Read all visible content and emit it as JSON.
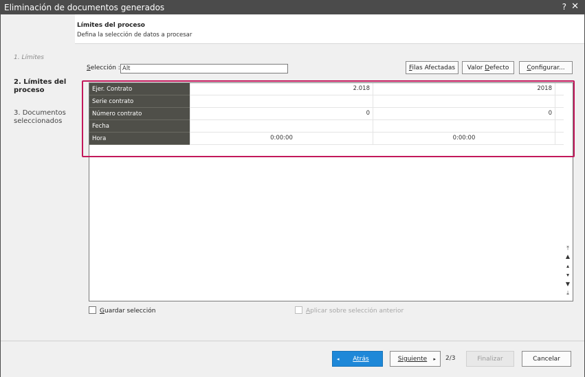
{
  "window": {
    "title": "Eliminación de documentos generados",
    "help_label": "?",
    "close_label": "✕"
  },
  "sidebar": {
    "steps": [
      {
        "label": "1. Límites"
      },
      {
        "label": "2. Límites del proceso"
      },
      {
        "label": "3. Documentos seleccionados"
      }
    ]
  },
  "header": {
    "title": "Límites del proceso",
    "subtitle": "Defina la selección de datos a procesar"
  },
  "selection": {
    "label_prefix": "S",
    "label_rest": "elección :",
    "value": "Alt"
  },
  "toolbar": {
    "filas_first": "F",
    "filas_rest": "ilas Afectadas",
    "valor_pre": "Valor ",
    "valor_u": "D",
    "valor_rest": "efecto",
    "config_first": "C",
    "config_rest": "onfigurar..."
  },
  "grid": {
    "rows": [
      {
        "label": "Ejer. Contrato",
        "from": "2.018",
        "to": "2018"
      },
      {
        "label": "Serie contrato",
        "from": "",
        "to": ""
      },
      {
        "label": "Número contrato",
        "from": "0",
        "to": "0"
      },
      {
        "label": "Fecha",
        "from": "",
        "to": ""
      },
      {
        "label": "Hora",
        "from": "0:00:00",
        "to": "0:00:00"
      }
    ]
  },
  "options": {
    "guardar_first": "G",
    "guardar_rest": "uardar selección",
    "aplicar_first": "A",
    "aplicar_rest": "plicar sobre selección anterior"
  },
  "footer": {
    "back_label": "Atrás",
    "next_label": "Siguiente",
    "page_indicator": "2/3",
    "finish_label": "Finalizar",
    "cancel_label": "Cancelar"
  },
  "colors": {
    "titlebar": "#4b4b4b",
    "grid_label_bg": "#4f4f49",
    "highlight": "#c2185b",
    "primary_button": "#1e88d8"
  }
}
